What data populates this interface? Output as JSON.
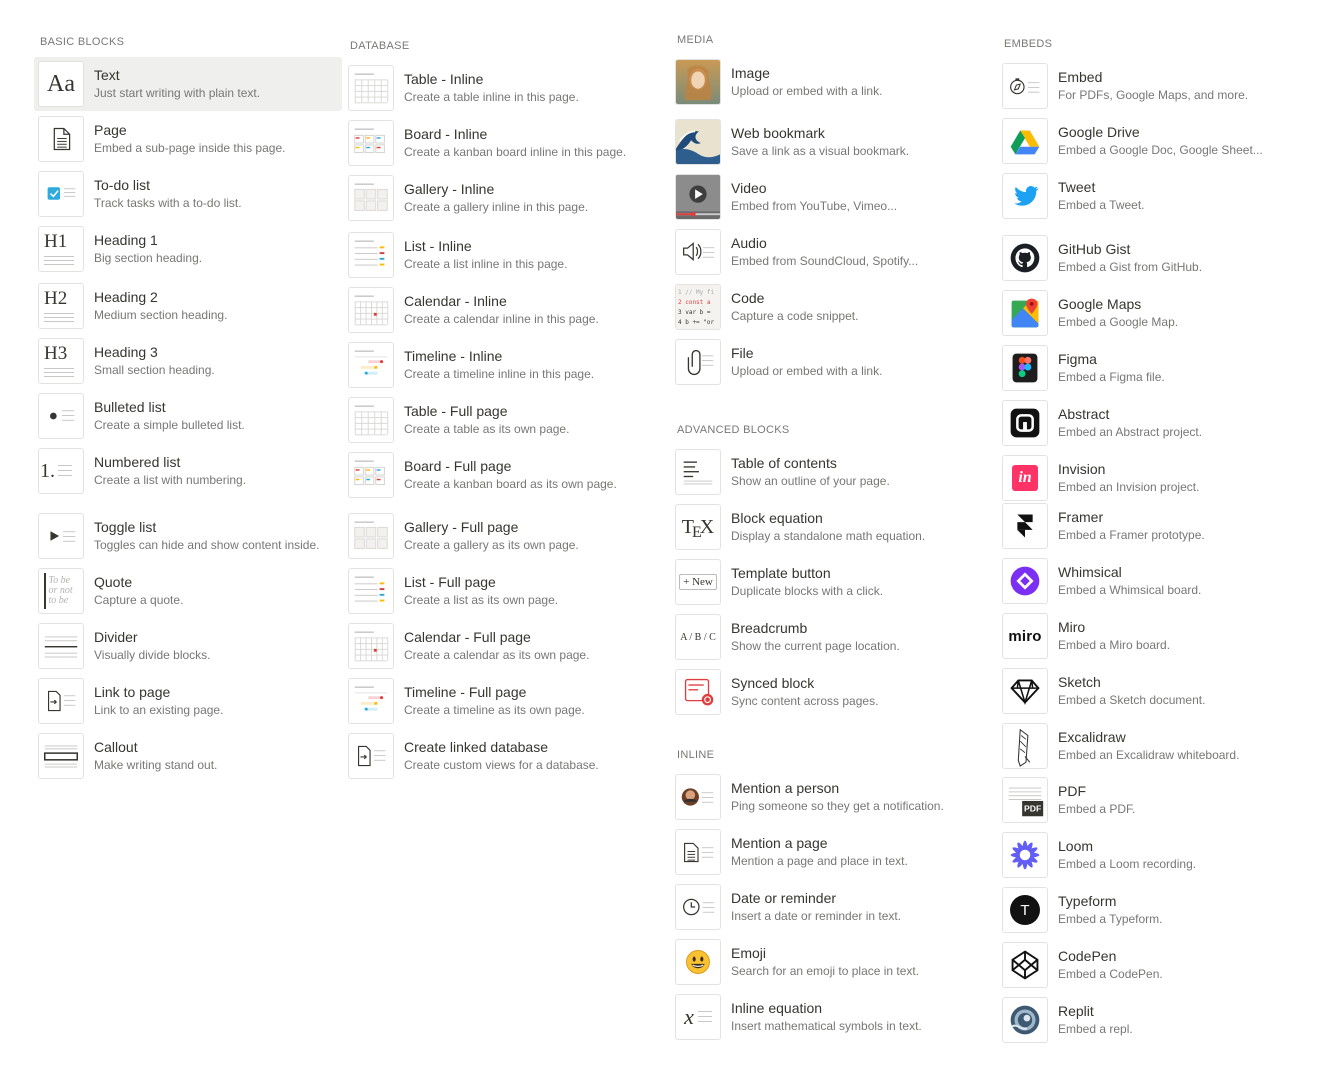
{
  "sections": {
    "basic_blocks": {
      "title": "BASIC BLOCKS",
      "items": [
        {
          "icon": "text-icon",
          "label": "Text",
          "desc": "Just start writing with plain text."
        },
        {
          "icon": "page-icon",
          "label": "Page",
          "desc": "Embed a sub-page inside this page."
        },
        {
          "icon": "todo-checkbox-icon",
          "label": "To-do list",
          "desc": "Track tasks with a to-do list."
        },
        {
          "icon": "heading1-icon",
          "label": "Heading 1",
          "desc": "Big section heading."
        },
        {
          "icon": "heading2-icon",
          "label": "Heading 2",
          "desc": "Medium section heading."
        },
        {
          "icon": "heading3-icon",
          "label": "Heading 3",
          "desc": "Small section heading."
        },
        {
          "icon": "bulleted-list-icon",
          "label": "Bulleted list",
          "desc": "Create a simple bulleted list."
        },
        {
          "icon": "numbered-list-icon",
          "label": "Numbered list",
          "desc": "Create a list with numbering."
        },
        {
          "icon": "toggle-list-icon",
          "label": "Toggle list",
          "desc": "Toggles can hide and show content inside."
        },
        {
          "icon": "quote-icon",
          "label": "Quote",
          "desc": "Capture a quote."
        },
        {
          "icon": "divider-icon",
          "label": "Divider",
          "desc": "Visually divide blocks."
        },
        {
          "icon": "link-to-page-icon",
          "label": "Link to page",
          "desc": "Link to an existing page."
        },
        {
          "icon": "callout-icon",
          "label": "Callout",
          "desc": "Make writing stand out."
        }
      ]
    },
    "database": {
      "title": "DATABASE",
      "items": [
        {
          "icon": "table-icon",
          "label": "Table - Inline",
          "desc": "Create a table inline in this page."
        },
        {
          "icon": "board-icon",
          "label": "Board - Inline",
          "desc": "Create a kanban board inline in this page."
        },
        {
          "icon": "gallery-icon",
          "label": "Gallery - Inline",
          "desc": "Create a gallery inline in this page."
        },
        {
          "icon": "list-icon",
          "label": "List - Inline",
          "desc": "Create a list inline in this page."
        },
        {
          "icon": "calendar-icon",
          "label": "Calendar - Inline",
          "desc": "Create a calendar inline in this page."
        },
        {
          "icon": "timeline-icon",
          "label": "Timeline - Inline",
          "desc": "Create a timeline inline in this page."
        },
        {
          "icon": "table-icon",
          "label": "Table - Full page",
          "desc": "Create a table as its own page."
        },
        {
          "icon": "board-icon",
          "label": "Board - Full page",
          "desc": "Create a kanban board as its own page."
        },
        {
          "icon": "gallery-icon",
          "label": "Gallery - Full page",
          "desc": "Create a gallery as its own page."
        },
        {
          "icon": "list-icon",
          "label": "List - Full page",
          "desc": "Create a list as its own page."
        },
        {
          "icon": "calendar-icon",
          "label": "Calendar - Full page",
          "desc": "Create a calendar as its own page."
        },
        {
          "icon": "timeline-icon",
          "label": "Timeline - Full page",
          "desc": "Create a timeline as its own page."
        },
        {
          "icon": "linked-database-icon",
          "label": "Create linked database",
          "desc": "Create custom views for a database."
        }
      ]
    },
    "media": {
      "title": "MEDIA",
      "items": [
        {
          "icon": "image-icon",
          "label": "Image",
          "desc": "Upload or embed with a link."
        },
        {
          "icon": "web-bookmark-icon",
          "label": "Web bookmark",
          "desc": "Save a link as a visual bookmark."
        },
        {
          "icon": "video-icon",
          "label": "Video",
          "desc": "Embed from YouTube, Vimeo..."
        },
        {
          "icon": "audio-icon",
          "label": "Audio",
          "desc": "Embed from SoundCloud, Spotify..."
        },
        {
          "icon": "code-icon",
          "label": "Code",
          "desc": "Capture a code snippet."
        },
        {
          "icon": "file-icon",
          "label": "File",
          "desc": "Upload or embed with a link."
        }
      ]
    },
    "advanced_blocks": {
      "title": "ADVANCED BLOCKS",
      "items": [
        {
          "icon": "table-of-contents-icon",
          "label": "Table of contents",
          "desc": "Show an outline of your page."
        },
        {
          "icon": "tex-icon",
          "label": "Block equation",
          "desc": "Display a standalone math equation."
        },
        {
          "icon": "template-button-icon",
          "label": "Template button",
          "desc": "Duplicate blocks with a click."
        },
        {
          "icon": "breadcrumb-icon",
          "label": "Breadcrumb",
          "desc": "Show the current page location."
        },
        {
          "icon": "synced-block-icon",
          "label": "Synced block",
          "desc": "Sync content across pages."
        }
      ]
    },
    "inline": {
      "title": "INLINE",
      "items": [
        {
          "icon": "mention-person-icon",
          "label": "Mention a person",
          "desc": "Ping someone so they get a notification."
        },
        {
          "icon": "mention-page-icon",
          "label": "Mention a page",
          "desc": "Mention a page and place in text."
        },
        {
          "icon": "clock-icon",
          "label": "Date or reminder",
          "desc": "Insert a date or reminder in text."
        },
        {
          "icon": "emoji-icon",
          "label": "Emoji",
          "desc": "Search for an emoji to place in text."
        },
        {
          "icon": "inline-equation-icon",
          "label": "Inline equation",
          "desc": "Insert mathematical symbols in text."
        }
      ]
    },
    "embeds": {
      "title": "EMBEDS",
      "items": [
        {
          "icon": "embed-compass-icon",
          "label": "Embed",
          "desc": "For PDFs, Google Maps, and more."
        },
        {
          "icon": "google-drive-icon",
          "label": "Google Drive",
          "desc": "Embed a Google Doc, Google Sheet..."
        },
        {
          "icon": "twitter-icon",
          "label": "Tweet",
          "desc": "Embed a Tweet."
        },
        {
          "icon": "github-icon",
          "label": "GitHub Gist",
          "desc": "Embed a Gist from GitHub."
        },
        {
          "icon": "google-maps-icon",
          "label": "Google Maps",
          "desc": "Embed a Google Map."
        },
        {
          "icon": "figma-icon",
          "label": "Figma",
          "desc": "Embed a Figma file."
        },
        {
          "icon": "abstract-icon",
          "label": "Abstract",
          "desc": "Embed an Abstract project."
        },
        {
          "icon": "invision-icon",
          "label": "Invision",
          "desc": "Embed an Invision project."
        },
        {
          "icon": "framer-icon",
          "label": "Framer",
          "desc": "Embed a Framer prototype."
        },
        {
          "icon": "whimsical-icon",
          "label": "Whimsical",
          "desc": "Embed a Whimsical board."
        },
        {
          "icon": "miro-icon",
          "label": "Miro",
          "desc": "Embed a Miro board."
        },
        {
          "icon": "sketch-icon",
          "label": "Sketch",
          "desc": "Embed a Sketch document."
        },
        {
          "icon": "excalidraw-icon",
          "label": "Excalidraw",
          "desc": "Embed an Excalidraw whiteboard."
        },
        {
          "icon": "pdf-icon",
          "label": "PDF",
          "desc": "Embed a PDF."
        },
        {
          "icon": "loom-icon",
          "label": "Loom",
          "desc": "Embed a Loom recording."
        },
        {
          "icon": "typeform-icon",
          "label": "Typeform",
          "desc": "Embed a Typeform."
        },
        {
          "icon": "codepen-icon",
          "label": "CodePen",
          "desc": "Embed a CodePen."
        },
        {
          "icon": "replit-icon",
          "label": "Replit",
          "desc": "Embed a repl."
        }
      ]
    }
  },
  "icon_glyphs": {
    "text": "Aa",
    "h1": "H1",
    "h2": "H2",
    "h3": "H3",
    "numbered": "1.",
    "quote": "To be or not to be",
    "tex": "TEX",
    "template": "+ New",
    "breadcrumb": "A / B / C",
    "pdf": "PDF",
    "miro": "miro",
    "invision": "in",
    "typeform": "T",
    "equation": "x",
    "code_lines": [
      "1 // My fi",
      "2 const a",
      "3 var b =",
      "4 b += \"or"
    ]
  },
  "colors": {
    "accent_blue": "#2eaadc",
    "selected_bg": "#efefee",
    "text_primary": "#37352f",
    "text_secondary": "#787774"
  }
}
